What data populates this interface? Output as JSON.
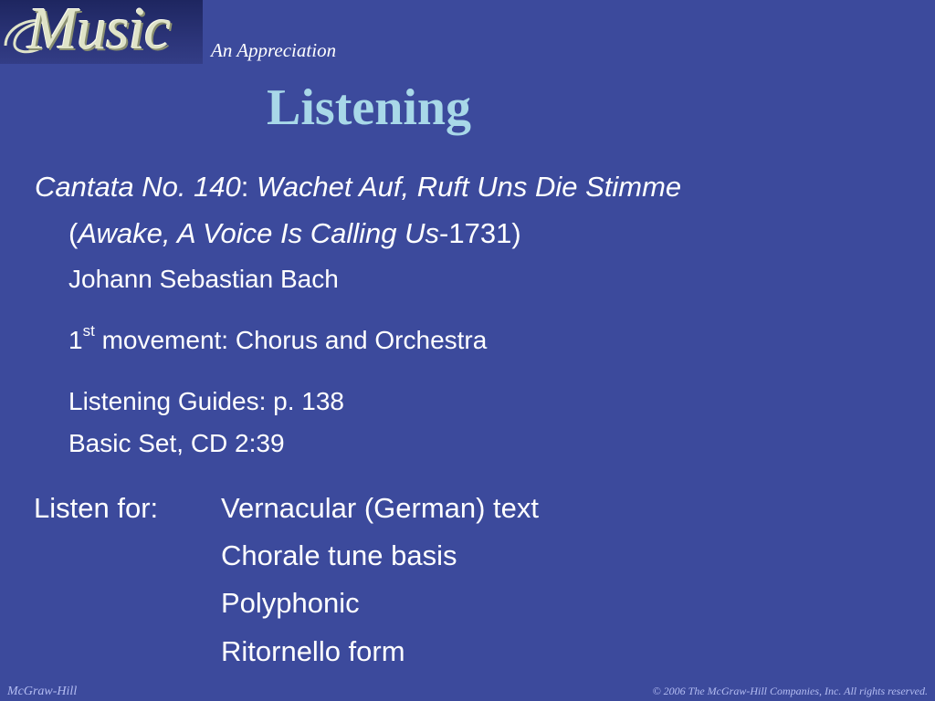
{
  "header": {
    "logo_text": "Music",
    "subtitle": "An Appreciation"
  },
  "slide": {
    "title": "Listening",
    "work": {
      "title_part1": "Cantata No. 140",
      "separator": ": ",
      "title_part2": "Wachet Auf, Ruft Uns Die Stimme",
      "open_paren": "(",
      "translation": "Awake, A Voice Is Calling Us",
      "year_part": "-1731)",
      "composer": "Johann Sebastian Bach"
    },
    "movement": {
      "number": "1",
      "ordinal": "st",
      "text": " movement: Chorus and Orchestra"
    },
    "guides": {
      "line1": "Listening Guides: p. 138",
      "line2": "Basic Set, CD 2:39"
    },
    "listen_for": {
      "label": "Listen for:",
      "items": [
        "Vernacular (German) text",
        "Chorale tune basis",
        "Polyphonic",
        "Ritornello form"
      ]
    }
  },
  "footer": {
    "publisher": "McGraw-Hill",
    "copyright": "© 2006 The McGraw-Hill Companies, Inc. All rights reserved."
  },
  "colors": {
    "background": "#3c4a9c",
    "title": "#a8d8e8",
    "footer_text": "#b4bdf2"
  }
}
